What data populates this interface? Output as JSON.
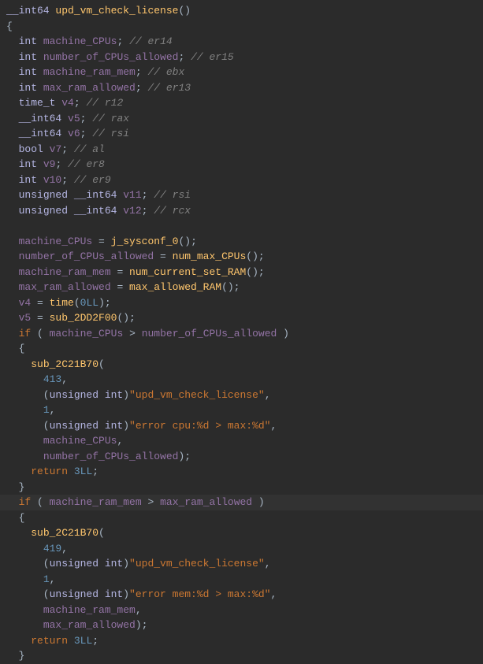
{
  "code": {
    "func_sig_type": "__int64",
    "func_name": "upd_vm_check_license",
    "decls": [
      {
        "type": "int",
        "name": "machine_CPUs",
        "comment": "// er14"
      },
      {
        "type": "int",
        "name": "number_of_CPUs_allowed",
        "comment": "// er15"
      },
      {
        "type": "int",
        "name": "machine_ram_mem",
        "comment": "// ebx"
      },
      {
        "type": "int",
        "name": "max_ram_allowed",
        "comment": "// er13"
      },
      {
        "type": "time_t",
        "name": "v4",
        "comment": "// r12"
      },
      {
        "type": "__int64",
        "name": "v5",
        "comment": "// rax"
      },
      {
        "type": "__int64",
        "name": "v6",
        "comment": "// rsi"
      },
      {
        "type": "bool",
        "name": "v7",
        "comment": "// al"
      },
      {
        "type": "int",
        "name": "v9",
        "comment": "// er8"
      },
      {
        "type": "int",
        "name": "v10",
        "comment": "// er9"
      },
      {
        "type": "unsigned __int64",
        "name": "v11",
        "comment": "// rsi"
      },
      {
        "type": "unsigned __int64",
        "name": "v12",
        "comment": "// rcx"
      }
    ],
    "assigns": [
      {
        "lhs": "machine_CPUs",
        "rhs_fn": "j_sysconf_0",
        "rhs_args": ""
      },
      {
        "lhs": "number_of_CPUs_allowed",
        "rhs_fn": "num_max_CPUs",
        "rhs_args": ""
      },
      {
        "lhs": "machine_ram_mem",
        "rhs_fn": "num_current_set_RAM",
        "rhs_args": ""
      },
      {
        "lhs": "max_ram_allowed",
        "rhs_fn": "max_allowed_RAM",
        "rhs_args": ""
      },
      {
        "lhs": "v4",
        "rhs_fn": "time",
        "rhs_args": "0LL"
      },
      {
        "lhs": "v5",
        "rhs_fn": "sub_2DD2F00",
        "rhs_args": ""
      }
    ],
    "if1": {
      "lhs": "machine_CPUs",
      "op": ">",
      "rhs": "number_of_CPUs_allowed",
      "call_fn": "sub_2C21B70",
      "arg0": "413",
      "cast": "unsigned int",
      "str1": "\"upd_vm_check_license\"",
      "arg2": "1",
      "str2": "\"error cpu:%d > max:%d\"",
      "arg4": "machine_CPUs",
      "arg5": "number_of_CPUs_allowed",
      "ret": "3LL"
    },
    "if2": {
      "lhs": "machine_ram_mem",
      "op": ">",
      "rhs": "max_ram_allowed",
      "call_fn": "sub_2C21B70",
      "arg0": "419",
      "cast": "unsigned int",
      "str1": "\"upd_vm_check_license\"",
      "arg2": "1",
      "str2": "\"error mem:%d > max:%d\"",
      "arg4": "machine_ram_mem",
      "arg5": "max_ram_allowed",
      "ret": "3LL"
    }
  }
}
